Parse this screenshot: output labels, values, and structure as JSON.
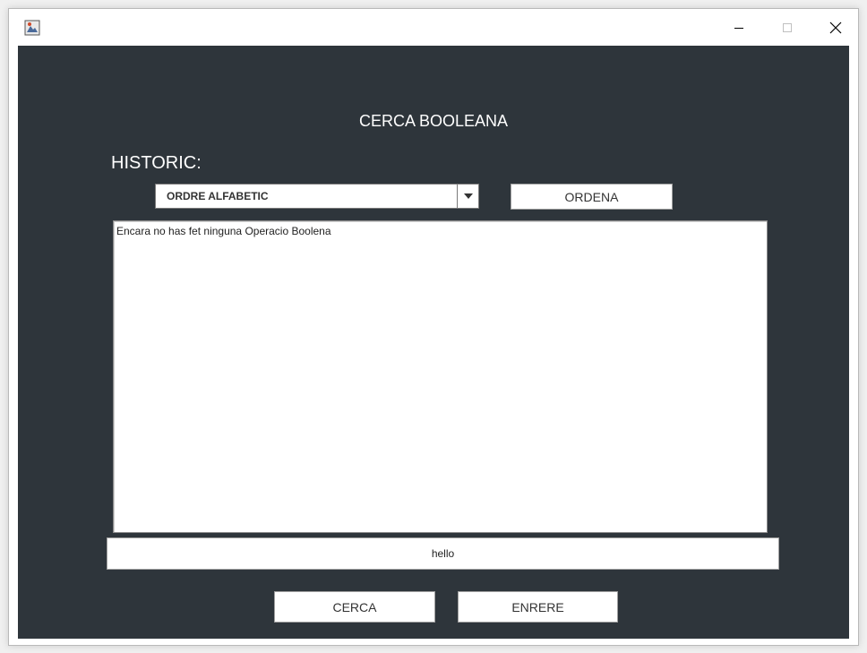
{
  "window": {
    "icons": {
      "app": "java-app-icon",
      "minimize": "minimize-icon",
      "maximize": "maximize-icon",
      "close": "close-icon"
    }
  },
  "main": {
    "title": "CERCA BOOLEANA",
    "historic_label": "HISTORIC:",
    "sort_select": {
      "selected": "ORDRE ALFABETIC"
    },
    "sort_button_label": "ORDENA",
    "history_text": "Encara no has fet ninguna Operacio Boolena",
    "query_value": "hello",
    "search_button_label": "CERCA",
    "back_button_label": "ENRERE"
  },
  "colors": {
    "background": "#2e353b",
    "text_light": "#ffffff",
    "field_bg": "#ffffff"
  }
}
